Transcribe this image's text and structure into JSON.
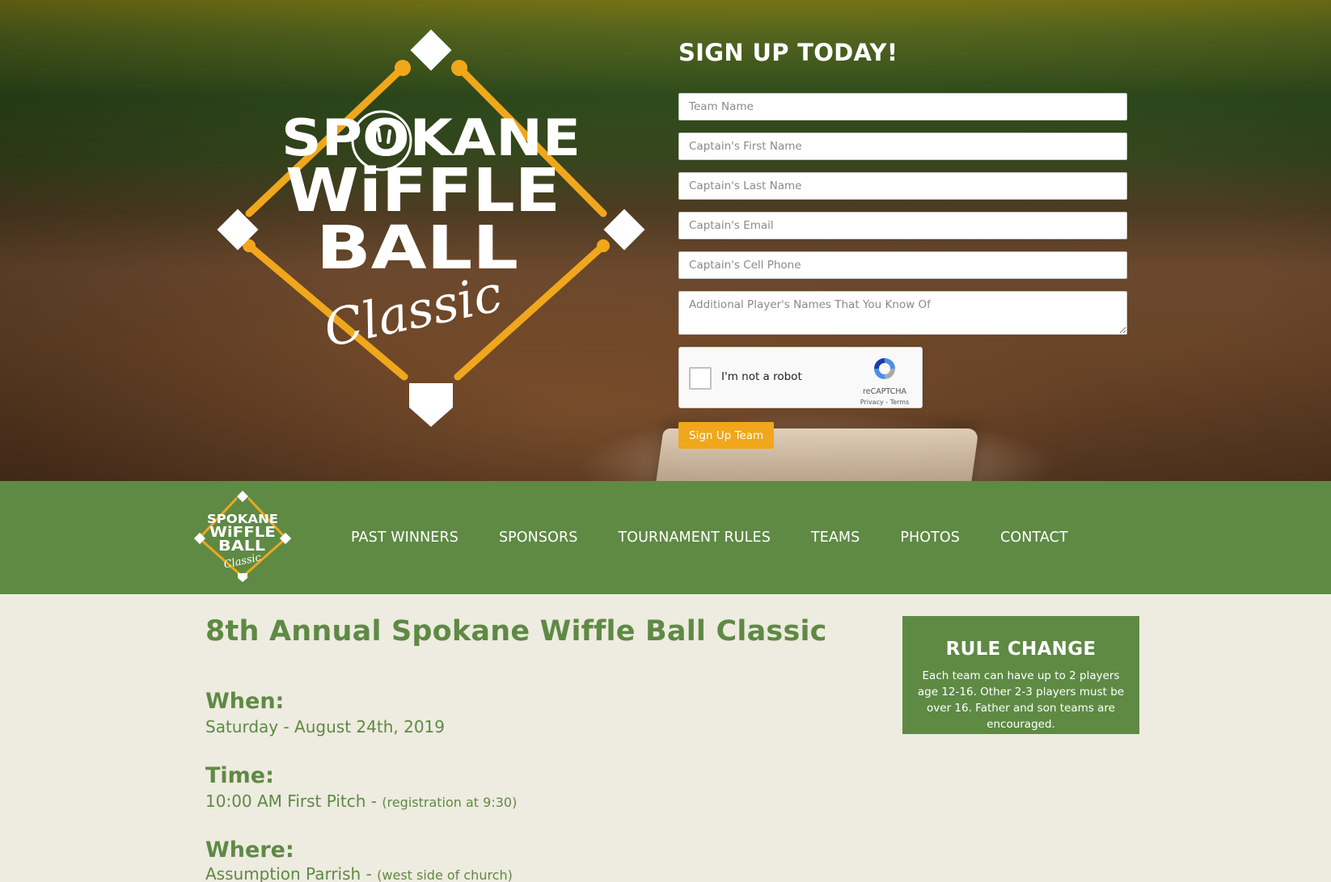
{
  "hero": {
    "logo": {
      "line1": "SPOKANE",
      "line2": "WiFFLE",
      "line3": "BALL",
      "line4": "Classic"
    },
    "form": {
      "title": "SIGN UP TODAY!",
      "fields": {
        "team_name": "Team Name",
        "captain_first": "Captain's First Name",
        "captain_last": "Captain's Last Name",
        "captain_email": "Captain's Email",
        "captain_cell": "Captain's Cell Phone",
        "additional_players": "Additional Player's Names That You Know Of"
      },
      "captcha": {
        "label": "I'm not a robot",
        "brand": "reCAPTCHA",
        "links": "Privacy - Terms"
      },
      "submit_label": "Sign Up Team"
    }
  },
  "nav": {
    "items": [
      {
        "label": "PAST WINNERS"
      },
      {
        "label": "SPONSORS"
      },
      {
        "label": "TOURNAMENT RULES"
      },
      {
        "label": "TEAMS"
      },
      {
        "label": "PHOTOS"
      },
      {
        "label": "CONTACT"
      }
    ]
  },
  "main": {
    "title": "8th Annual Spokane Wiffle Ball Classic",
    "when": {
      "label": "When:",
      "value": "Saturday - August 24th, 2019"
    },
    "time": {
      "label": "Time:",
      "value": "10:00 AM First Pitch - ",
      "note": "(registration at 9:30)"
    },
    "where": {
      "label": "Where:",
      "value": "Assumption Parrish - ",
      "note": "(west side of church)"
    }
  },
  "rule_change": {
    "title": "RULE CHANGE",
    "text": "Each team can have up to 2 players age 12-16. Other 2-3 players must be over 16. Father and son teams are encouraged."
  },
  "colors": {
    "brand_green": "#5e8a44",
    "accent_orange": "#f0a71c",
    "page_bg": "#eeebe0"
  }
}
